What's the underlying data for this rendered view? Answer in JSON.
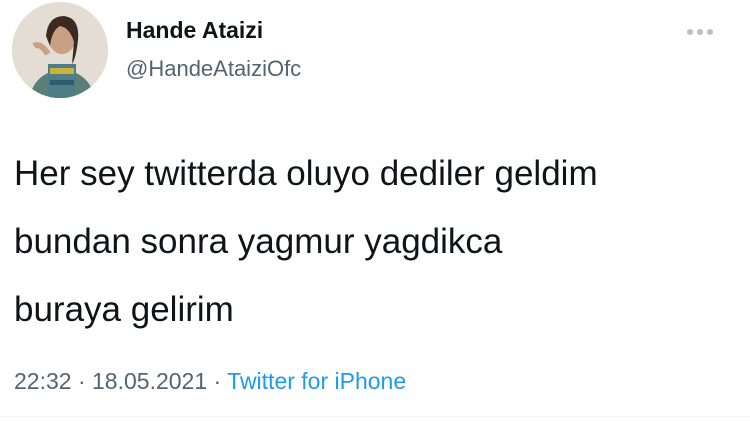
{
  "author": {
    "display_name": "Hande Ataizi",
    "handle": "@HandeAtaiziOfc"
  },
  "tweet": {
    "text_lines": [
      "Her sey twitterda oluyo dediler geldim",
      "bundan sonra yagmur yagdikca",
      "buraya gelirim"
    ],
    "time": "22:32",
    "separator": "·",
    "date": "18.05.2021",
    "source": "Twitter for iPhone"
  },
  "icons": {
    "more": "more-horizontal-icon",
    "avatar": "profile-avatar"
  },
  "colors": {
    "text": "#0f1419",
    "muted": "#536471",
    "link": "#1d9bf0"
  }
}
